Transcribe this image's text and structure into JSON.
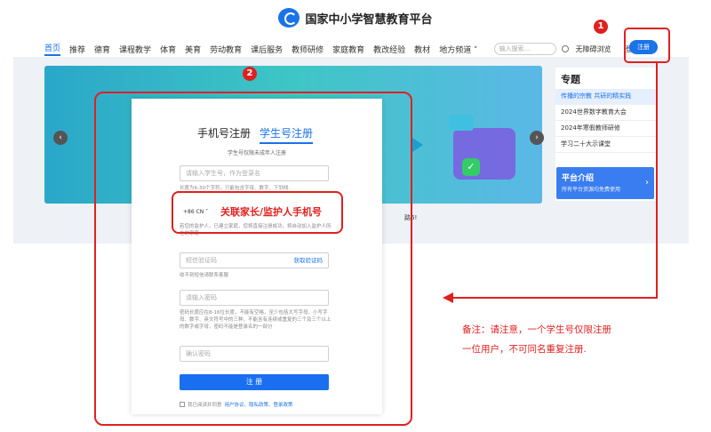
{
  "header": {
    "site_title": "国家中小学智慧教育平台"
  },
  "nav": {
    "items": [
      "首页",
      "推荐",
      "德育",
      "课程教学",
      "体育",
      "美育",
      "劳动教育",
      "课后服务",
      "教师研修",
      "家庭教育",
      "教改经验",
      "教材",
      "地方频道 ˅"
    ],
    "search_placeholder": "输入搜索...",
    "accessibility": "无障碍浏览",
    "login": "登录",
    "register": "注册"
  },
  "banner": {
    "prev_icon": "‹",
    "next_icon": "›",
    "check_icon": "✓"
  },
  "side_panel": {
    "title": "专题",
    "items": [
      "传播的宗教 共研的精实践",
      "2024世界数字教育大会",
      "2024年寒假教师研修",
      "学习二十大示课堂"
    ],
    "intro_title": "平台介绍",
    "intro_sub": "所有平台资源均免费使用",
    "intro_arrow": "›"
  },
  "behind_text": "路6!",
  "modal": {
    "tab_phone": "手机号注册",
    "tab_student": "学生号注册",
    "tab_sub": "学生号仅限未成年人注册",
    "student_id_placeholder": "请输入学生号，作为登录名",
    "student_id_hint": "长度为6-30个字符，只能包含字母、数字、下划线",
    "phone_prefix": "+86 CN ˅",
    "phone_hint": "若您的监护人，已建立家庭，您将直接注册成功，将自动加入监护人所在的家庭",
    "sms_placeholder": "短信验证码",
    "sms_link": "获取验证码",
    "sms_hint": "收不到短信请联系客服",
    "password_placeholder": "请输入密码",
    "password_hint": "密码长度应在8-16位长度，不能有空格，至少包括大写字母、小写字母、数字、英文符号中的三种，不能含有连续或重复的三个及三个以上的数字或字母，密码不能是登录名的一部分",
    "confirm_placeholder": "确认密码",
    "submit_label": "注 册",
    "agree_prefix": "我已阅读并同意",
    "agree_links": "用户协议、隐私政策、登录政策"
  },
  "annotations": {
    "num_1": "1",
    "num_2": "2",
    "label_3": "关联家长/监护人手机号",
    "note_line1": "备注：请注意，一个学生号仅限注册",
    "note_line2": "一位用户，不可同名重复注册."
  },
  "colors": {
    "brand_blue": "#1a73e8",
    "annotation_red": "#e02020"
  }
}
